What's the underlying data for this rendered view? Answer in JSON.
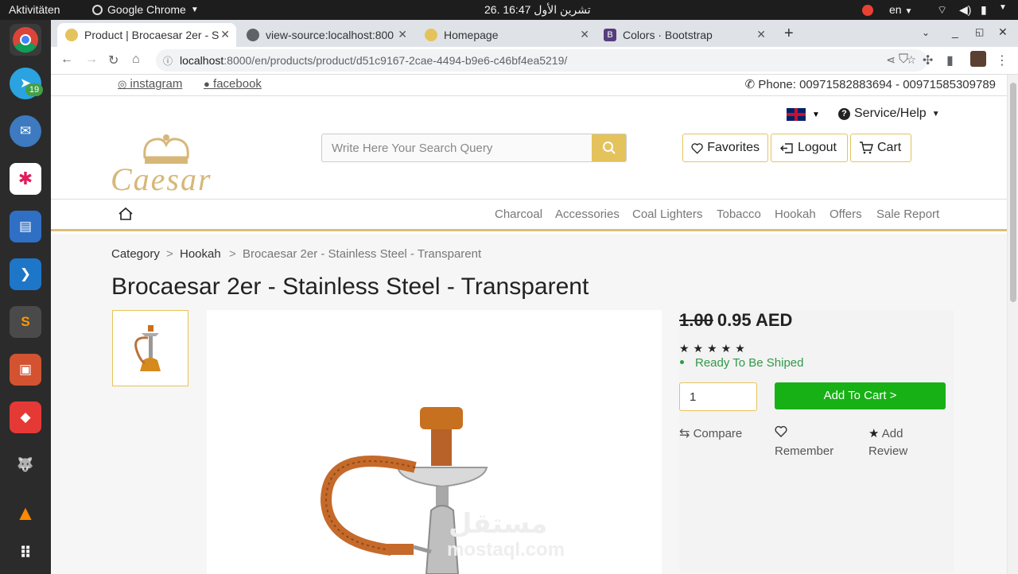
{
  "os": {
    "activities": "Aktivitäten",
    "app_name": "Google Chrome",
    "clock": "26. تشرين الأول 16:47",
    "language": "en",
    "telegram_badge": "19"
  },
  "browser": {
    "tabs": [
      {
        "label": "Product | Brocaesar 2er - S"
      },
      {
        "label": "view-source:localhost:800"
      },
      {
        "label": "Homepage"
      },
      {
        "label": "Colors · Bootstrap"
      }
    ],
    "url_host": "localhost",
    "url_path": ":8000/en/products/product/d51c9167-2cae-4494-b9e6-c46bf4ea5219/"
  },
  "site": {
    "instagram": "instagram",
    "facebook": "facebook",
    "phone": "Phone: 00971582883694 - 00971585309789",
    "logo": "Caesar",
    "service": "Service/Help",
    "search_placeholder": "Write Here Your Search Query",
    "favorites": "Favorites",
    "logout": "Logout",
    "cart": "Cart",
    "nav": [
      "Charcoal",
      "Accessories",
      "Coal Lighters",
      "Tobacco",
      "Hookah",
      "Offers",
      "Sale Report"
    ]
  },
  "breadcrumb": {
    "category": "Category",
    "sep": ">",
    "hookah": "Hookah",
    "product": "Brocaesar 2er - Stainless Steel - Transparent"
  },
  "product": {
    "title": "Brocaesar 2er - Stainless Steel - Transparent",
    "old_price": "1.00",
    "price": "0.95 AED",
    "stars": "★★★★★",
    "stock": "Ready To Be Shiped",
    "qty": "1",
    "add_to_cart": "Add To Cart >",
    "compare": "Compare",
    "remember": "Remember",
    "add": "Add",
    "review": "Review"
  },
  "watermark": {
    "line1": "مستقل",
    "line2": "mostaql.com"
  },
  "colors": {
    "accent": "#e5c35c",
    "success": "#17b115",
    "stock_green": "#2e9948"
  }
}
